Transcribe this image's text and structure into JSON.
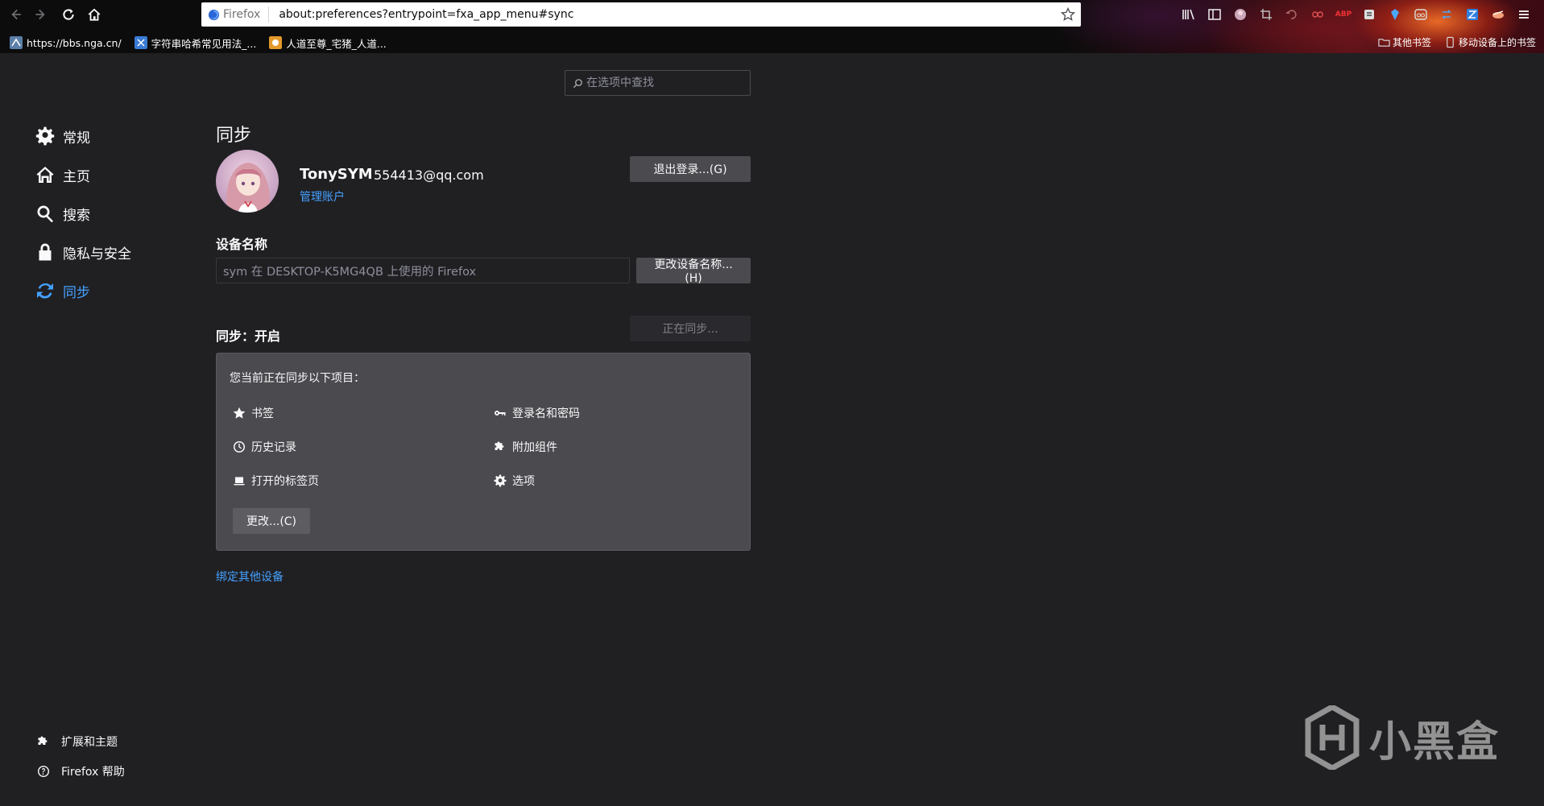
{
  "browser": {
    "url": "about:preferences?entrypoint=fxa_app_menu#sync",
    "identity_label": "Firefox",
    "bookmarks": [
      {
        "label": "https://bbs.nga.cn/"
      },
      {
        "label": "字符串哈希常见用法_..."
      },
      {
        "label": "人道至尊_宅猪_人道..."
      }
    ],
    "bookmarks_right": {
      "other": "其他书签",
      "mobile": "移动设备上的书签"
    },
    "toolbar_badges": {
      "abp": "ABP"
    }
  },
  "search": {
    "placeholder": "在选项中查找"
  },
  "sidebar": {
    "items": [
      {
        "label": "常规"
      },
      {
        "label": "主页"
      },
      {
        "label": "搜索"
      },
      {
        "label": "隐私与安全"
      },
      {
        "label": "同步"
      }
    ],
    "footer": [
      {
        "label": "扩展和主题"
      },
      {
        "label": "Firefox 帮助"
      }
    ]
  },
  "main": {
    "title": "同步",
    "account": {
      "name": "TonySYM",
      "email": "554413@qq.com",
      "manage_label": "管理账户",
      "signout_label": "退出登录...(G)"
    },
    "device": {
      "label": "设备名称",
      "value": "sym 在 DESKTOP-K5MG4QB 上使用的 Firefox",
      "rename_label": "更改设备名称...(H)"
    },
    "sync": {
      "status_label": "同步：开启",
      "syncing_label": "正在同步...",
      "intro": "您当前正在同步以下项目：",
      "engines": [
        {
          "label": "书签"
        },
        {
          "label": "登录名和密码"
        },
        {
          "label": "历史记录"
        },
        {
          "label": "附加组件"
        },
        {
          "label": "打开的标签页"
        },
        {
          "label": "选项"
        }
      ],
      "change_label": "更改...(C)"
    },
    "pair_label": "绑定其他设备"
  },
  "watermark": {
    "text": "小黑盒"
  },
  "colors": {
    "background": "#202023",
    "accent": "#45a1ff",
    "button": "#4a4a4f",
    "text": "#f9f9fa"
  }
}
